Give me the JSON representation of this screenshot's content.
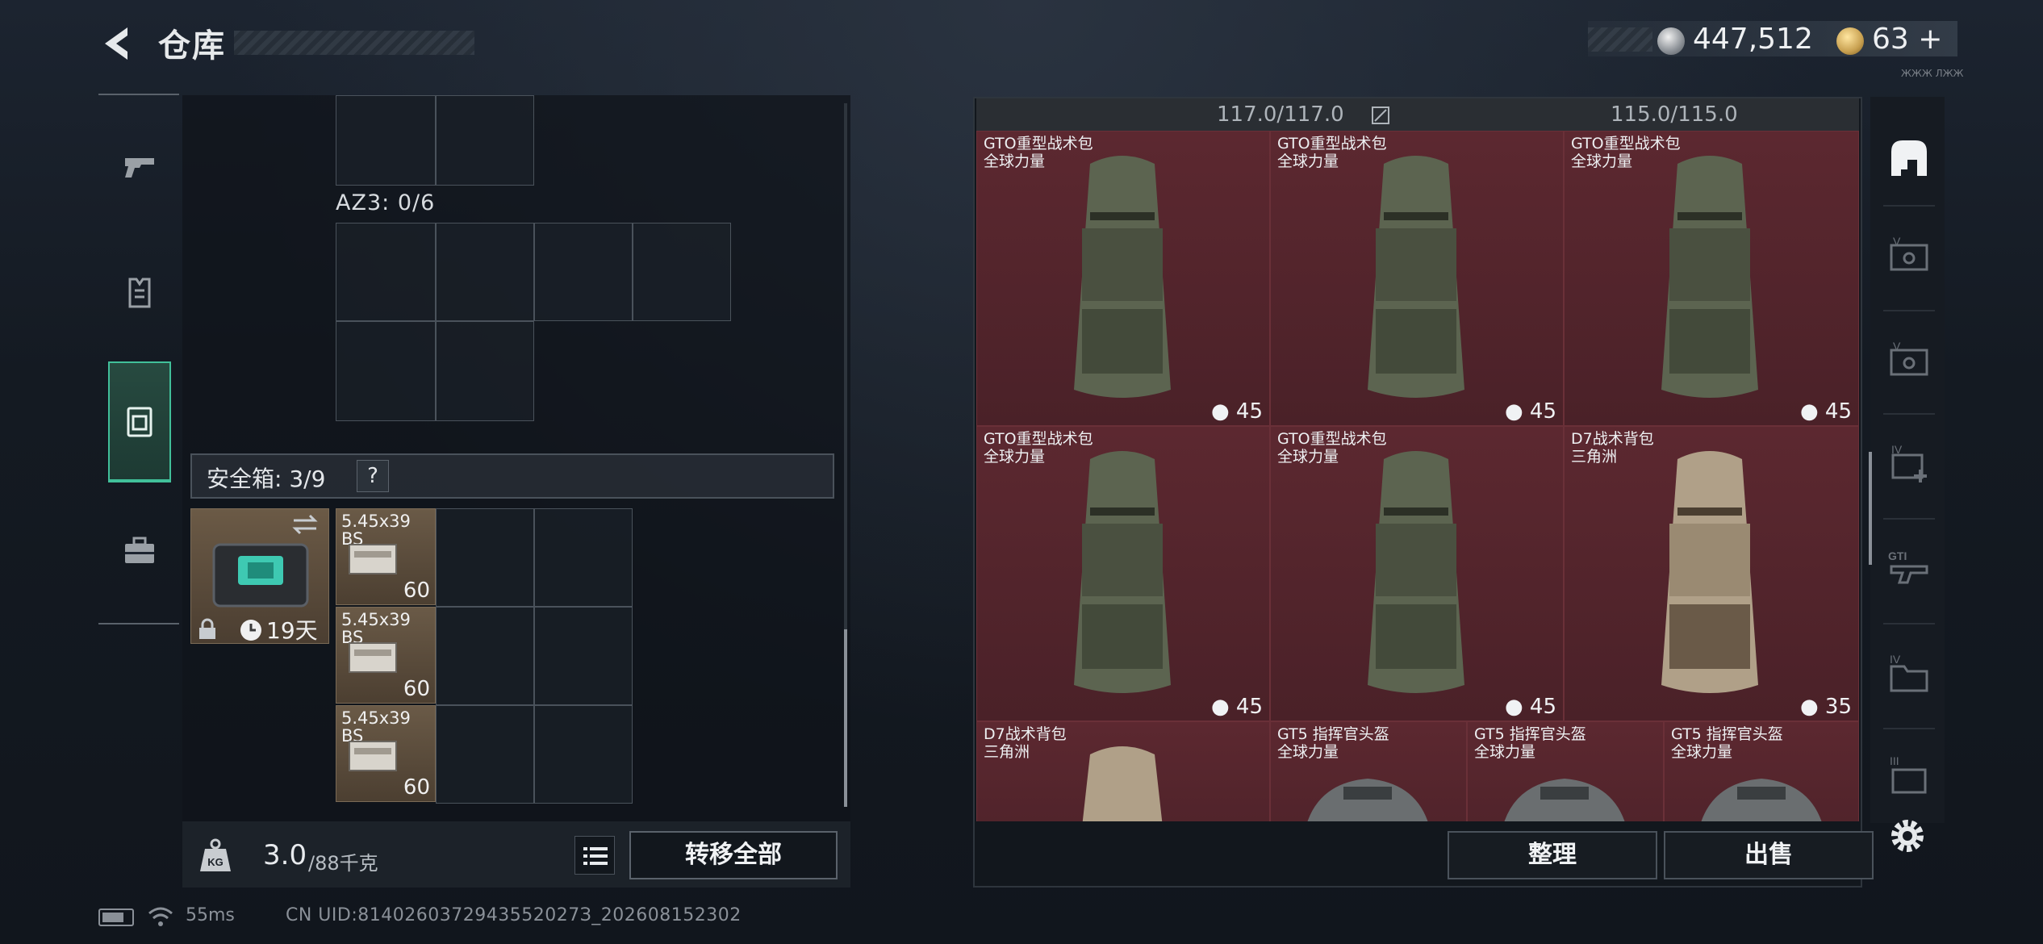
{
  "header": {
    "title": "仓库",
    "silver_amount": "447,512",
    "gold_amount": "63",
    "gold_plus": "+",
    "tiny_text": "ЖЖЖ ЛЖЖ"
  },
  "left_nav": [
    "weapon-tab",
    "equipment-tab",
    "safebox-tab",
    "toolbox-tab"
  ],
  "left_panel": {
    "az3_label": "AZ3: 0/6",
    "safebox_label": "安全箱: 3/9",
    "help_label": "?",
    "safebox_days": "19天",
    "ammo": [
      {
        "name_line1": "5.45x39",
        "name_line2": "BS",
        "count": "60"
      },
      {
        "name_line1": "5.45x39",
        "name_line2": "BS",
        "count": "60"
      },
      {
        "name_line1": "5.45x39",
        "name_line2": "BS",
        "count": "60"
      }
    ]
  },
  "footer_left": {
    "weight_value": "3.0",
    "weight_max": "/88千克",
    "transfer_all": "转移全部"
  },
  "status_bar": {
    "ping": "55ms",
    "uid": "CN UID:8140260372943552027З_202608152302"
  },
  "stash": {
    "capacity_1": "117.0/117.0",
    "capacity_2": "115.0/115.0",
    "items": [
      {
        "name": "GTO重型战术包",
        "brand": "全球力量",
        "count": "45"
      },
      {
        "name": "GTO重型战术包",
        "brand": "全球力量",
        "count": "45"
      },
      {
        "name": "GTO重型战术包",
        "brand": "全球力量",
        "count": "45"
      },
      {
        "name": "GTO重型战术包",
        "brand": "全球力量",
        "count": "45"
      },
      {
        "name": "GTO重型战术包",
        "brand": "全球力量",
        "count": "45"
      },
      {
        "name": "D7战术背包",
        "brand": "三角洲",
        "count": "35"
      },
      {
        "name": "D7战术背包",
        "brand": "三角洲",
        "count": ""
      },
      {
        "name": "GT5 指挥官头盔",
        "brand": "全球力量",
        "count": ""
      },
      {
        "name": "GT5 指挥官头盔",
        "brand": "全球力量",
        "count": ""
      },
      {
        "name": "GT5 指挥官头盔",
        "brand": "全球力量",
        "count": ""
      }
    ]
  },
  "footer_right": {
    "sort_label": "整理",
    "sell_label": "出售"
  },
  "right_rail": [
    "home-icon",
    "v-container-icon",
    "v-container-icon",
    "iv-medkit-icon",
    "gti-gun-icon",
    "iv-folder-icon",
    "iii-crate-icon",
    "settings-icon"
  ],
  "colors": {
    "stash_bg": "#4b2126",
    "accent_green": "#41c09a",
    "panel_bg": "#12171d"
  }
}
